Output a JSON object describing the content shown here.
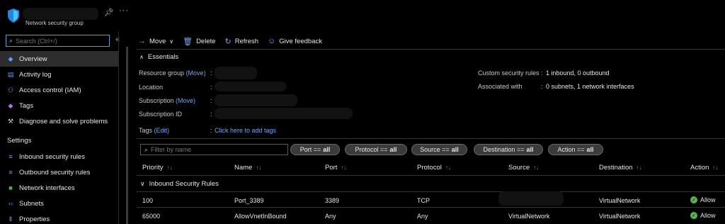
{
  "header": {
    "resource_type": "Network security group",
    "icons": [
      "nsg-shield-icon",
      "pin-icon",
      "more-icon"
    ]
  },
  "sidebar": {
    "search_placeholder": "Search (Ctrl+/)",
    "items": [
      {
        "label": "Overview",
        "icon": "shield-icon",
        "active": true
      },
      {
        "label": "Activity log",
        "icon": "activity-log-icon"
      },
      {
        "label": "Access control (IAM)",
        "icon": "iam-icon"
      },
      {
        "label": "Tags",
        "icon": "tag-icon"
      },
      {
        "label": "Diagnose and solve problems",
        "icon": "wrench-icon"
      }
    ],
    "settings_heading": "Settings",
    "settings_items": [
      {
        "label": "Inbound security rules",
        "icon": "inbound-rules-icon"
      },
      {
        "label": "Outbound security rules",
        "icon": "outbound-rules-icon"
      },
      {
        "label": "Network interfaces",
        "icon": "nic-icon"
      },
      {
        "label": "Subnets",
        "icon": "subnet-icon"
      },
      {
        "label": "Properties",
        "icon": "properties-icon"
      }
    ]
  },
  "toolbar": {
    "move": "Move",
    "delete": "Delete",
    "refresh": "Refresh",
    "feedback": "Give feedback"
  },
  "essentials": {
    "title": "Essentials",
    "resource_group_label": "Resource group",
    "resource_group_link": "(Move)",
    "location_label": "Location",
    "subscription_label": "Subscription",
    "subscription_link": "(Move)",
    "subscription_id_label": "Subscription ID",
    "tags_label": "Tags",
    "tags_link": "(Edit)",
    "tags_value": "Click here to add tags",
    "custom_rules_label": "Custom security rules",
    "custom_rules_value": "1 inbound, 0 outbound",
    "associated_label": "Associated with",
    "associated_value": "0 subnets, 1 network interfaces"
  },
  "filters": {
    "placeholder": "Filter by name",
    "pills": [
      {
        "name": "Port ==",
        "value": "all"
      },
      {
        "name": "Protocol ==",
        "value": "all"
      },
      {
        "name": "Source ==",
        "value": "all"
      },
      {
        "name": "Destination ==",
        "value": "all"
      },
      {
        "name": "Action ==",
        "value": "all"
      }
    ]
  },
  "table": {
    "columns": [
      "Priority",
      "Name",
      "Port",
      "Protocol",
      "Source",
      "Destination",
      "Action"
    ],
    "group": "Inbound Security Rules",
    "rows": [
      {
        "priority": "100",
        "name": "Port_3389",
        "port": "3389",
        "protocol": "TCP",
        "source": "",
        "destination": "VirtualNetwork",
        "action": "Allow"
      },
      {
        "priority": "65000",
        "name": "AllowVnetInBound",
        "port": "Any",
        "protocol": "Any",
        "source": "VirtualNetwork",
        "destination": "VirtualNetwork",
        "action": "Allow"
      }
    ]
  },
  "colors": {
    "accent": "#6fa8ef",
    "allow": "#4fb84f",
    "active_bg": "#2d2d2d"
  }
}
